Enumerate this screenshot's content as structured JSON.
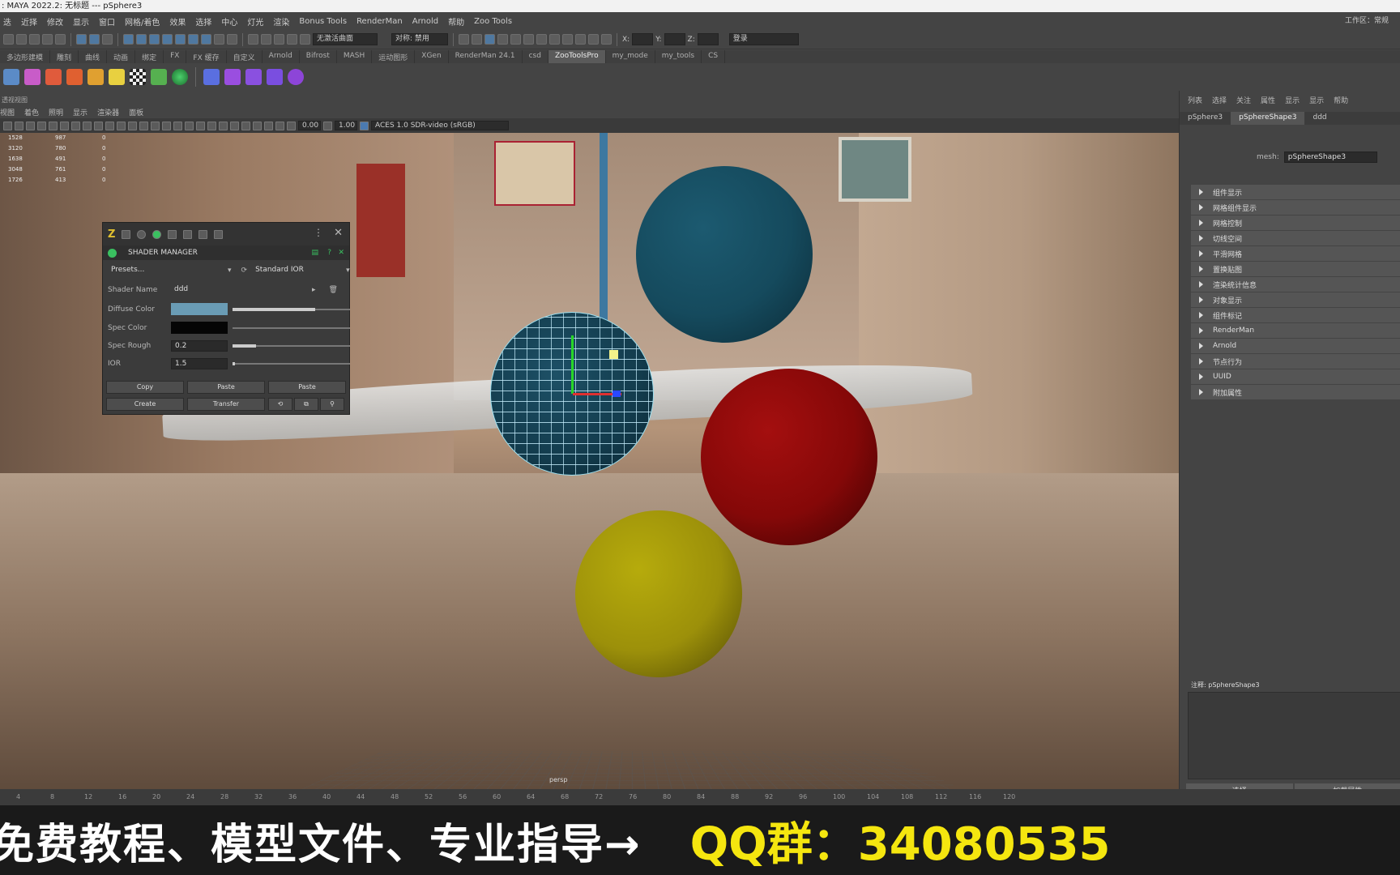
{
  "window": {
    "title": ": MAYA 2022.2: 无标题   ---   pSphere3",
    "top_right": "工作区：常规"
  },
  "menus": [
    "迭",
    "近择",
    "修改",
    "显示",
    "窗口",
    "网格/着色",
    "效果",
    "选择",
    "中心",
    "灯光",
    "渲染",
    "Bonus Tools",
    "RenderMan",
    "Arnold",
    "帮助",
    "Zoo Tools"
  ],
  "statusline": {
    "selection_field": "无激活曲面",
    "symmetry_label": "对称: 禁用",
    "x_label": "X:",
    "y_label": "Y:",
    "z_label": "Z:",
    "login": "登录"
  },
  "shelf_tabs": [
    "多边形建模",
    "雕刻",
    "曲线",
    "动画",
    "绑定",
    "FX",
    "FX 缓存",
    "自定义",
    "Arnold",
    "Bifrost",
    "MASH",
    "运动图形",
    "XGen",
    "RenderMan 24.1",
    "csd",
    "ZooToolsPro",
    "my_mode",
    "my_tools",
    "CS"
  ],
  "shelf_active": "ZooToolsPro",
  "viewport": {
    "panel_title": "透视视图",
    "menu": [
      "视图",
      "着色",
      "照明",
      "显示",
      "渲染器",
      "面板"
    ],
    "exposure": "0.00",
    "gamma": "1.00",
    "colorspace": "ACES 1.0 SDR-video (sRGB)",
    "camera_label": "persp",
    "hud": [
      [
        "1528",
        "987",
        "0"
      ],
      [
        "3120",
        "780",
        "0"
      ],
      [
        "1638",
        "491",
        "0"
      ],
      [
        "3048",
        "761",
        "0"
      ],
      [
        "1726",
        "413",
        "0"
      ]
    ]
  },
  "shader_manager": {
    "title": "SHADER MANAGER",
    "presets": "Presets...",
    "shader_type": "Standard IOR",
    "shader_name_label": "Shader Name",
    "shader_name_value": "ddd",
    "diffuse_label": "Diffuse Color",
    "diffuse_color": "#6a9cb5",
    "spec_color_label": "Spec Color",
    "spec_color": "#050505",
    "spec_rough_label": "Spec Rough",
    "spec_rough_value": "0.2",
    "ior_label": "IOR",
    "ior_value": "1.5",
    "btn_copy": "Copy",
    "btn_paste": "Paste",
    "btn_paste2": "Paste",
    "btn_create": "Create",
    "btn_transfer": "Transfer"
  },
  "attribute_editor": {
    "menu": [
      "列表",
      "选择",
      "关注",
      "属性",
      "显示",
      "显示",
      "帮助"
    ],
    "tabs": [
      "pSphere3",
      "pSphereShape3",
      "ddd"
    ],
    "active_tab": "pSphereShape3",
    "mesh_label": "mesh:",
    "mesh_value": "pSphereShape3",
    "sections": [
      "组件显示",
      "网格组件显示",
      "网格控制",
      "切线空间",
      "平滑网格",
      "置换贴图",
      "渲染统计信息",
      "对象显示",
      "组件标记",
      "RenderMan",
      "Arnold",
      "节点行为",
      "UUID",
      "附加属性"
    ],
    "notes_label": "注释: pSphereShape3",
    "btn_select": "选择",
    "btn_load": "加载属性"
  },
  "timeline_ticks": [
    "4",
    "8",
    "12",
    "16",
    "20",
    "24",
    "28",
    "32",
    "36",
    "40",
    "44",
    "48",
    "52",
    "56",
    "60",
    "64",
    "68",
    "72",
    "76",
    "80",
    "84",
    "88",
    "92",
    "96",
    "100",
    "104",
    "108",
    "112",
    "116",
    "120"
  ],
  "banner": {
    "left_text": "免费教程、模型文件、专业指导→",
    "right_text": "QQ群：34080535"
  }
}
